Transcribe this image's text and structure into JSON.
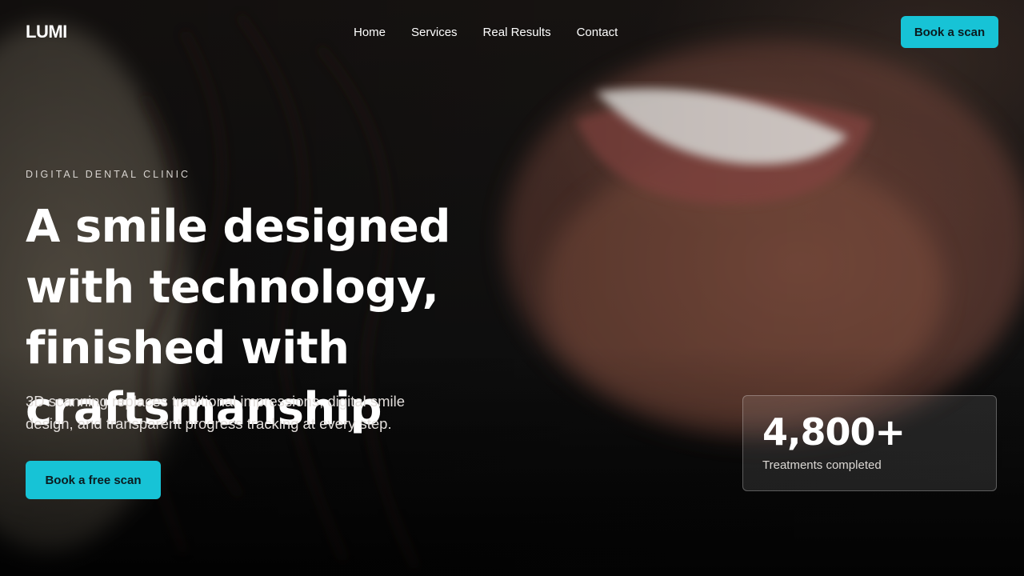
{
  "brand": {
    "logo": "LUMI"
  },
  "nav": {
    "links": [
      "Home",
      "Services",
      "Real Results",
      "Contact"
    ],
    "cta_label": "Book a scan"
  },
  "hero": {
    "eyebrow": "DIGITAL DENTAL CLINIC",
    "headline": "A smile designed with technology, finished with craftsmanship",
    "subtitle": "3D scanning replaces traditional impressions, digital smile design, and transparent progress tracking at every step.",
    "cta_label": "Book a free scan"
  },
  "stat": {
    "value": "4,800+",
    "label": "Treatments completed"
  },
  "colors": {
    "accent": "#17c3d6",
    "background": "#0b0b0b"
  }
}
